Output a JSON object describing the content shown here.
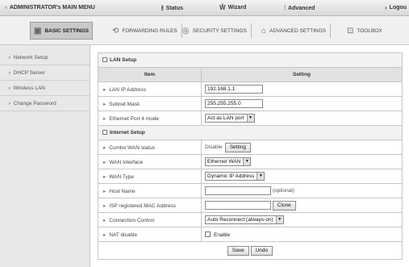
{
  "topbar": {
    "main_menu": "ADMINISTRATOR's MAIN MENU",
    "status": "Status",
    "wizard": "Wizard",
    "advanced": "Advanced",
    "logout": "Logou"
  },
  "tabs": [
    {
      "label": "BASIC SETTINGS",
      "icon": "settings-icon"
    },
    {
      "label": "FORWARDING RULES",
      "icon": "forwarding-icon"
    },
    {
      "label": "SECURITY SETTINGS",
      "icon": "security-icon"
    },
    {
      "label": "ADVANCED SETTINGS",
      "icon": "advanced-icon"
    },
    {
      "label": "TOOLBOX",
      "icon": "toolbox-icon"
    }
  ],
  "sidebar": {
    "items": [
      {
        "label": "Network Setup"
      },
      {
        "label": "DHCP Server"
      },
      {
        "label": "Wireless LAN"
      },
      {
        "label": "Change Password"
      }
    ]
  },
  "lan_setup": {
    "title": "LAN Setup",
    "col_item": "Item",
    "col_setting": "Setting",
    "lan_ip_label": "LAN IP Address",
    "lan_ip_value": "192.168.1.1",
    "subnet_label": "Subnet Mask",
    "subnet_value": "255.255.255.0",
    "port4_label": "Ethernet Port 4 mode",
    "port4_value": "Act as LAN port"
  },
  "internet_setup": {
    "title": "Internet Setup",
    "combo_status_label": "Combo WAN status",
    "combo_status_value": "Disable",
    "setting_button": "Setting",
    "wan_interface_label": "WAN Interface",
    "wan_interface_value": "Ethernet WAN",
    "wan_type_label": "WAN Type",
    "wan_type_value": "Dynamic IP Address",
    "host_name_label": "Host Name",
    "host_name_value": "",
    "host_name_hint": "(optional)",
    "mac_label": "ISP registered MAC Address",
    "mac_value": "",
    "clone_button": "Clone",
    "connection_label": "Connection Control",
    "connection_value": "Auto Reconnect (always-on)",
    "nat_label": "NAT disable",
    "nat_enable_label": "Enable"
  },
  "actions": {
    "save": "Save",
    "undo": "Undo"
  }
}
